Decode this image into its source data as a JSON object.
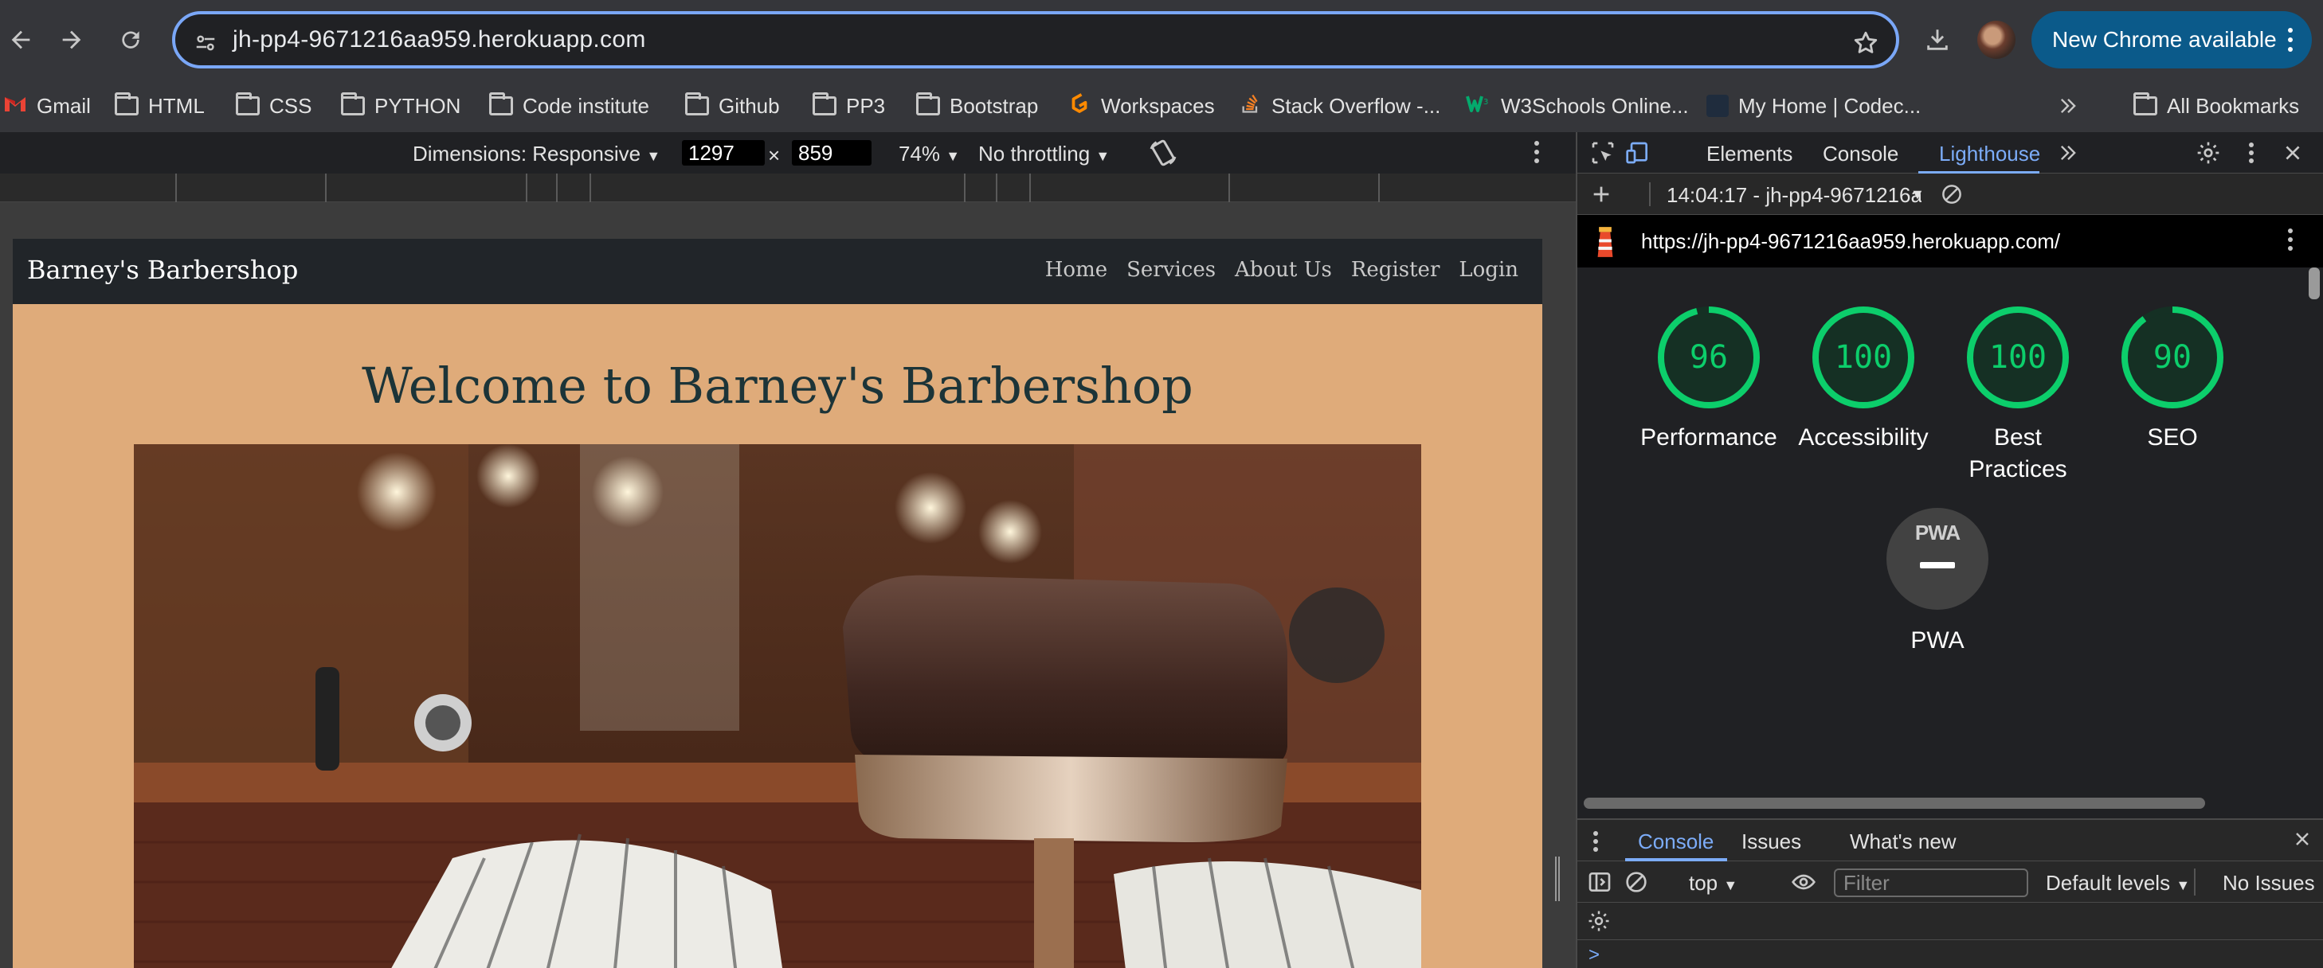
{
  "browser": {
    "url": "jh-pp4-9671216aa959.herokuapp.com",
    "update_label": "New Chrome available"
  },
  "bookmarks": [
    {
      "label": "Gmail",
      "icon": "gmail-icon"
    },
    {
      "label": "HTML",
      "icon": "folder-icon"
    },
    {
      "label": "CSS",
      "icon": "folder-icon"
    },
    {
      "label": "PYTHON",
      "icon": "folder-icon"
    },
    {
      "label": "Code institute",
      "icon": "folder-icon"
    },
    {
      "label": "Github",
      "icon": "folder-icon"
    },
    {
      "label": "PP3",
      "icon": "folder-icon"
    },
    {
      "label": "Bootstrap",
      "icon": "folder-icon"
    },
    {
      "label": "Workspaces",
      "icon": "gitpod-icon"
    },
    {
      "label": "Stack Overflow -...",
      "icon": "stackoverflow-icon"
    },
    {
      "label": "W3Schools Online...",
      "icon": "w3schools-icon"
    },
    {
      "label": "My Home | Codec...",
      "icon": "codecademy-icon"
    }
  ],
  "all_bookmarks_label": "All Bookmarks",
  "device_toolbar": {
    "dimensions_label": "Dimensions: Responsive",
    "width": "1297",
    "times": "×",
    "height": "859",
    "zoom": "74%",
    "throttling": "No throttling"
  },
  "site": {
    "brand": "Barney's Barbershop",
    "nav": [
      "Home",
      "Services",
      "About Us",
      "Register",
      "Login"
    ],
    "heading": "Welcome to Barney's Barbershop"
  },
  "devtools": {
    "tabs": [
      "Elements",
      "Console",
      "Lighthouse"
    ],
    "active_tab": "Lighthouse",
    "report_selector": "14:04:17 - jh-pp4-9671216a",
    "report_url": "https://jh-pp4-9671216aa959.herokuapp.com/",
    "scores": [
      {
        "label": "Performance",
        "value": "96",
        "fraction": 0.96
      },
      {
        "label": "Accessibility",
        "value": "100",
        "fraction": 1.0
      },
      {
        "label": "Best\nPractices",
        "value": "100",
        "fraction": 1.0
      },
      {
        "label": "SEO",
        "value": "90",
        "fraction": 0.9
      }
    ],
    "pwa": {
      "badge": "PWA",
      "label": "PWA"
    },
    "score_color": "#0cce6b"
  },
  "drawer": {
    "tabs": [
      "Console",
      "Issues",
      "What's new"
    ],
    "active_tab": "Console",
    "context": "top",
    "filter_placeholder": "Filter",
    "levels": "Default levels",
    "issues": "No Issues",
    "prompt": ">"
  }
}
